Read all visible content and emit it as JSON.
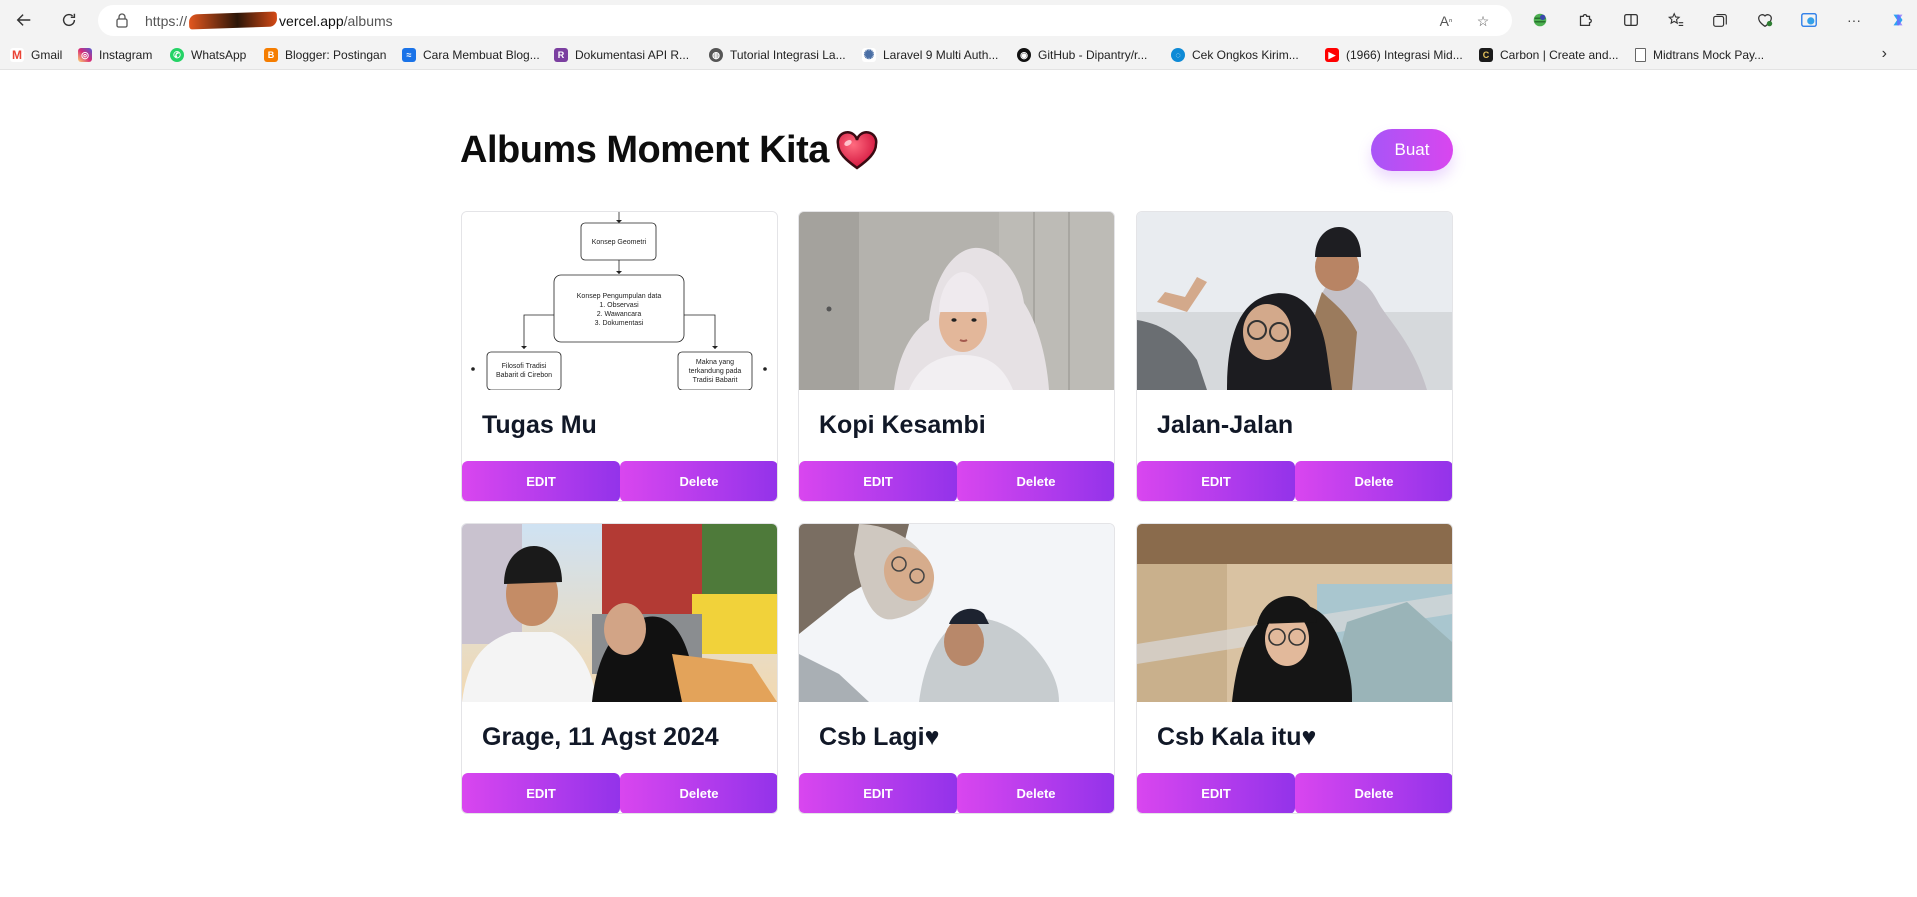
{
  "browser": {
    "url_prefix": "https://",
    "url_host": "vercel.app",
    "url_path": "/albums"
  },
  "bookmarks": [
    {
      "label": "Gmail",
      "icon": "gmail-icon",
      "color": "#ea4335"
    },
    {
      "label": "Instagram",
      "icon": "instagram-icon",
      "color": "#d62976"
    },
    {
      "label": "WhatsApp",
      "icon": "whatsapp-icon",
      "color": "#25d366"
    },
    {
      "label": "Blogger: Postingan",
      "icon": "blogger-icon",
      "color": "#f57d00"
    },
    {
      "label": "Cara Membuat Blog...",
      "icon": "blog-icon",
      "color": "#1a73e8"
    },
    {
      "label": "Dokumentasi API R...",
      "icon": "raja-ongkir-icon",
      "color": "#7b3fa0"
    },
    {
      "label": "Tutorial Integrasi La...",
      "icon": "globe-icon",
      "color": "#555555"
    },
    {
      "label": "Laravel 9 Multi Auth...",
      "icon": "gear-icon",
      "color": "#4a6fa5"
    },
    {
      "label": "GitHub - Dipantry/r...",
      "icon": "github-icon",
      "color": "#111111"
    },
    {
      "label": "Cek Ongkos Kirim...",
      "icon": "shipping-icon",
      "color": "#0e8ad6"
    },
    {
      "label": "(1966) Integrasi Mid...",
      "icon": "youtube-icon",
      "color": "#ff0000"
    },
    {
      "label": "Carbon | Create and...",
      "icon": "carbon-icon",
      "color": "#1b1b1b"
    },
    {
      "label": "Midtrans Mock Pay...",
      "icon": "page-icon",
      "color": "#666666"
    }
  ],
  "page": {
    "title": "Albums Moment Kita",
    "create_button": "Buat"
  },
  "albums": [
    {
      "title": "Tugas Mu",
      "edit": "EDIT",
      "delete": "Delete"
    },
    {
      "title": "Kopi Kesambi",
      "edit": "EDIT",
      "delete": "Delete"
    },
    {
      "title": "Jalan-Jalan",
      "edit": "EDIT",
      "delete": "Delete"
    },
    {
      "title": "Grage, 11 Agst 2024",
      "edit": "EDIT",
      "delete": "Delete"
    },
    {
      "title": "Csb Lagi♥",
      "edit": "EDIT",
      "delete": "Delete"
    },
    {
      "title": "Csb Kala itu♥",
      "edit": "EDIT",
      "delete": "Delete"
    }
  ],
  "thumb1_diagram": {
    "box_top": "Konsep Geometri",
    "box_mid_title": "Konsep Pengumpulan data",
    "box_mid_items": [
      "1. Observasi",
      "2. Wawancara",
      "3. Dokumentasi"
    ],
    "box_left": [
      "Filosofi Tradisi",
      "Babarit di Cirebon"
    ],
    "box_right": [
      "Makna yang",
      "terkandung pada",
      "Tradisi Babarit"
    ]
  },
  "colors": {
    "accent_from": "#d946ef",
    "accent_to": "#9333ea",
    "create_from": "#a855f7",
    "create_to": "#d946ef"
  }
}
